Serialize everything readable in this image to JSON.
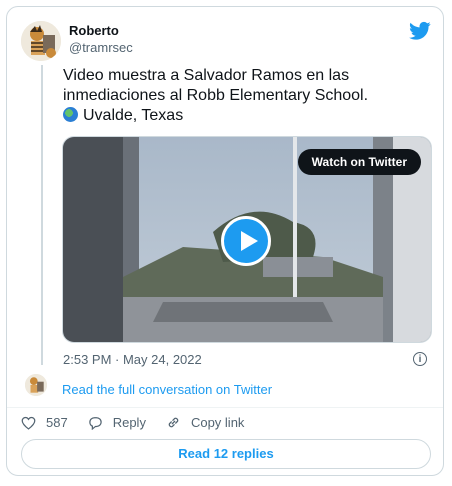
{
  "author": {
    "name": "Roberto",
    "handle": "@tramrsec"
  },
  "tweet": {
    "line1": "Video muestra a Salvador Ramos en las",
    "line2": "inmediaciones al Robb Elementary School.",
    "line3": "Uvalde, Texas",
    "timestamp": "2:53 PM · May 24, 2022"
  },
  "video": {
    "watch_label": "Watch on Twitter"
  },
  "conversation_link": "Read the full conversation on Twitter",
  "actions": {
    "likes": "587",
    "reply_label": "Reply",
    "copy_link_label": "Copy link"
  },
  "read_replies_label": "Read 12 replies",
  "colors": {
    "accent": "#1d9bf0",
    "text": "#0f1419",
    "muted": "#536471",
    "border": "#cfd9de"
  },
  "icons": [
    "twitter-bird-icon",
    "globe-icon",
    "play-icon",
    "info-icon",
    "heart-icon",
    "reply-icon",
    "link-icon"
  ]
}
